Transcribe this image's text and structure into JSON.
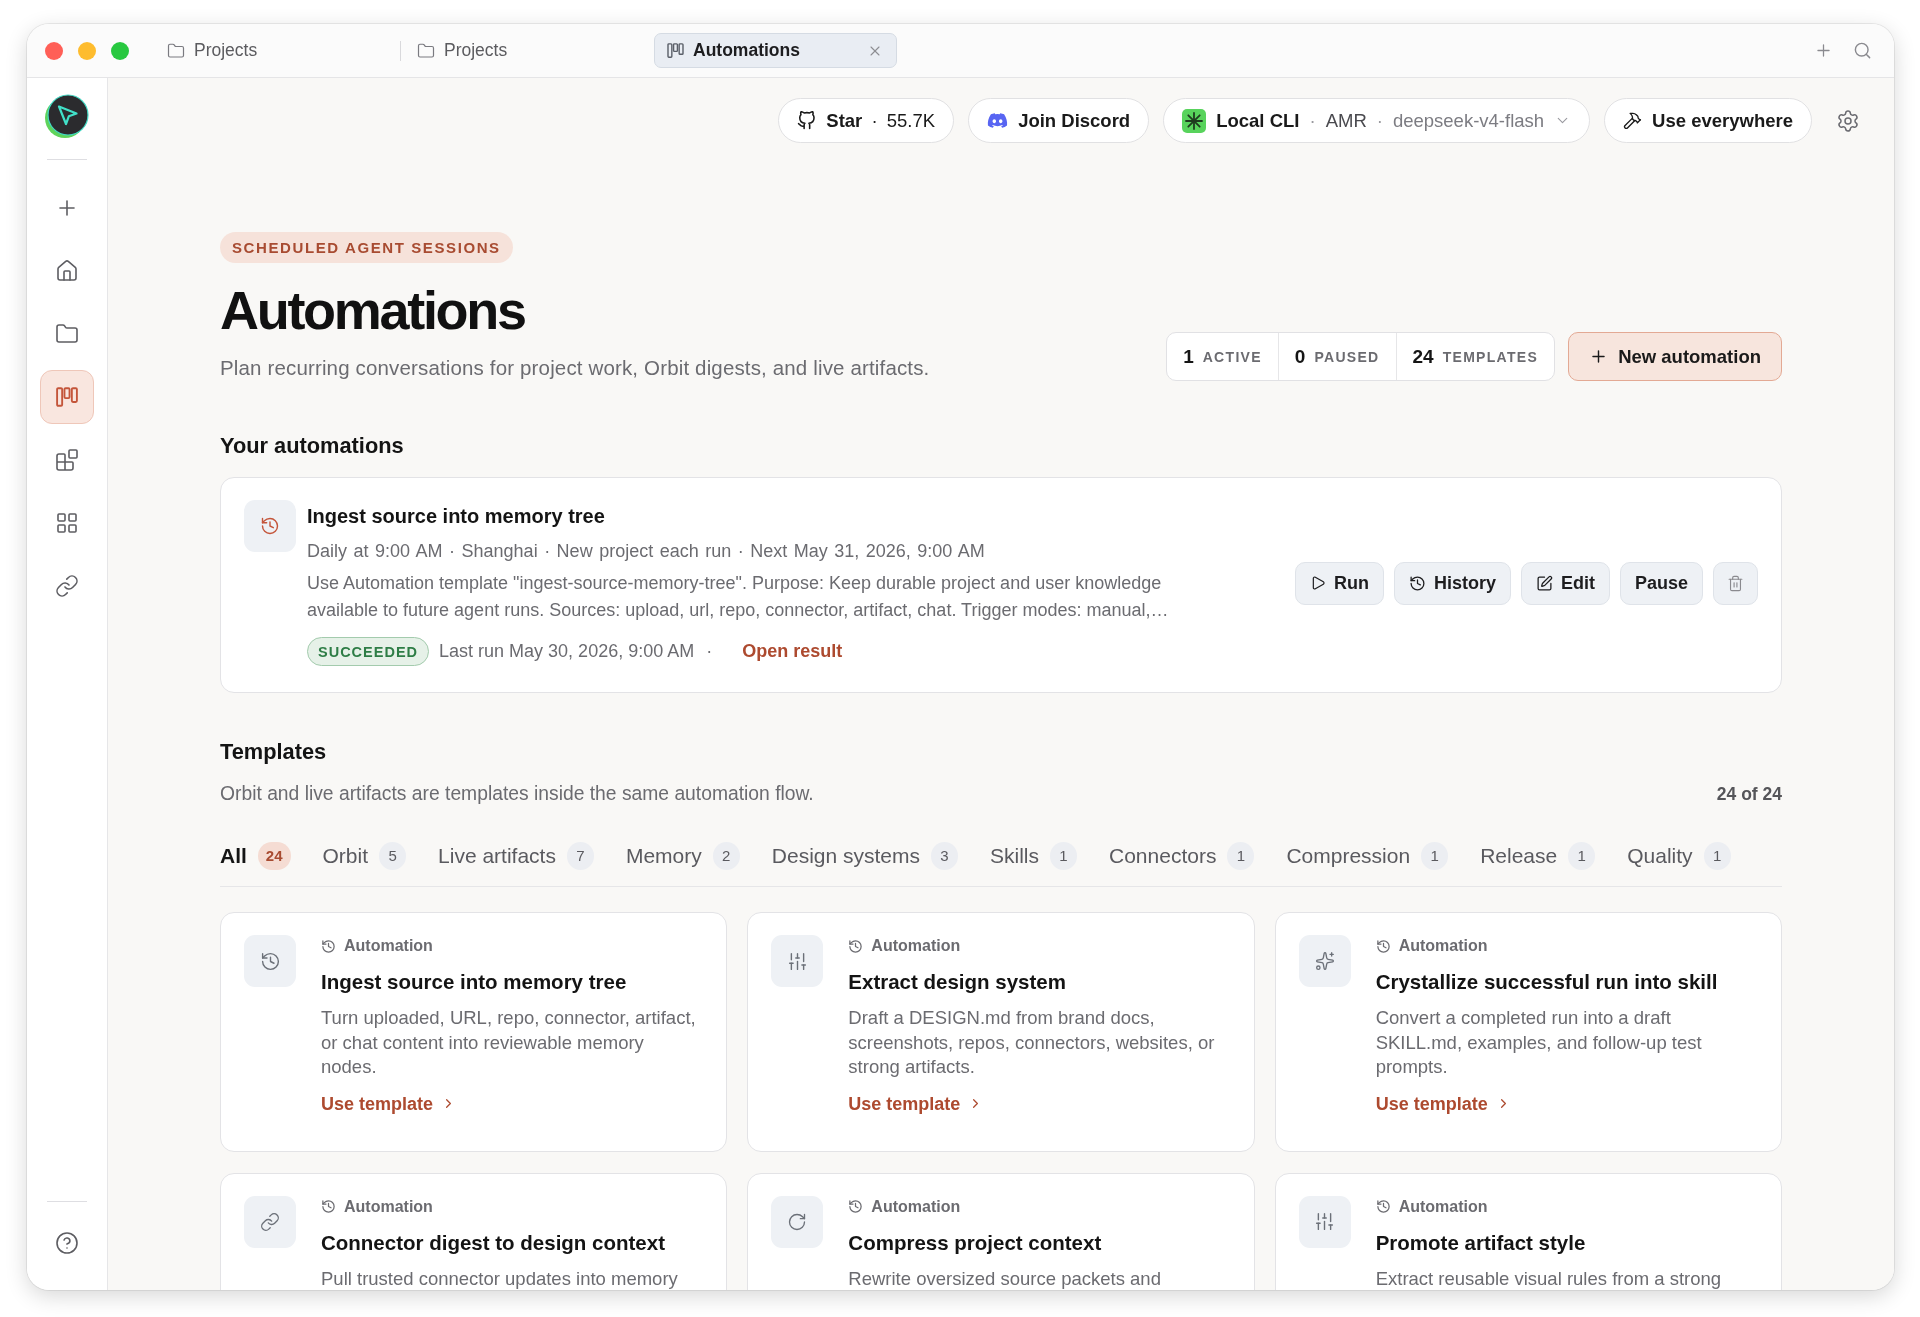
{
  "window": {
    "tabs": [
      {
        "label": "Projects",
        "kind": "project",
        "selected": false
      },
      {
        "label": "Projects",
        "kind": "project",
        "selected": false
      },
      {
        "label": "Automations",
        "kind": "automations",
        "selected": true
      }
    ]
  },
  "sidebar": {
    "items": [
      {
        "selected": false
      },
      {
        "selected": false
      },
      {
        "selected": false
      },
      {
        "selected": true
      },
      {
        "selected": false
      },
      {
        "selected": false
      },
      {
        "selected": false
      }
    ]
  },
  "toolbar": {
    "github": "**Star** · 55.7K",
    "discord": "Join Discord",
    "model_picker": {
      "runtime": "Local CLI",
      "provider": "AMR",
      "model": "deepseek-v4-flash",
      "separator": "·"
    },
    "share": "Use everywhere"
  },
  "header": {
    "eyebrow": "SCHEDULED AGENT SESSIONS",
    "title": "Automations",
    "subtitle": "Plan recurring conversations for project work, Orbit digests, and live artifacts.",
    "stats": [
      {
        "value": "1",
        "label": "ACTIVE"
      },
      {
        "value": "0",
        "label": "PAUSED"
      },
      {
        "value": "24",
        "label": "TEMPLATES"
      }
    ],
    "new_button": "New automation"
  },
  "automations": {
    "title": "Your automations",
    "items": [
      {
        "title": "Ingest source into memory tree",
        "schedule": "Daily at 9:00 AM · Shanghai · New project each run · Next May 31, 2026, 9:00 AM",
        "description": "Use Automation template \"ingest-source-memory-tree\". Purpose: Keep durable project and user knowledge available to future agent runs. Sources: upload, url, repo, connector, artifact, chat. Trigger modes: manual,…",
        "status": {
          "label": "SUCCEEDED",
          "kind": "success"
        },
        "last_run": "Last run May 30, 2026, 9:00 AM",
        "separator": "·",
        "result_link": "Open result",
        "actions": [
          {
            "kind": "run",
            "label": "Run"
          },
          {
            "kind": "history",
            "label": "History"
          },
          {
            "kind": "edit",
            "label": "Edit"
          },
          {
            "kind": "pause",
            "label": "Pause"
          },
          {
            "kind": "delete"
          }
        ]
      }
    ]
  },
  "templates": {
    "title": "Templates",
    "description": "Orbit and live artifacts are templates inside the same automation flow.",
    "count": "24 of 24",
    "filters": [
      {
        "label": "All",
        "count": "24",
        "selected": true
      },
      {
        "label": "Orbit",
        "count": "5",
        "selected": false
      },
      {
        "label": "Live artifacts",
        "count": "7",
        "selected": false
      },
      {
        "label": "Memory",
        "count": "2",
        "selected": false
      },
      {
        "label": "Design systems",
        "count": "3",
        "selected": false
      },
      {
        "label": "Skills",
        "count": "1",
        "selected": false
      },
      {
        "label": "Connectors",
        "count": "1",
        "selected": false
      },
      {
        "label": "Compression",
        "count": "1",
        "selected": false
      },
      {
        "label": "Release",
        "count": "1",
        "selected": false
      },
      {
        "label": "Quality",
        "count": "1",
        "selected": false
      }
    ],
    "cards": [
      {
        "eyebrow": "Automation",
        "title": "Ingest source into memory tree",
        "description": "Turn uploaded, URL, repo, connector, artifact, or chat content into reviewable memory nodes.",
        "action": "Use template"
      },
      {
        "eyebrow": "Automation",
        "title": "Extract design system",
        "description": "Draft a DESIGN.md from brand docs, screenshots, repos, connectors, websites, or strong artifacts.",
        "action": "Use template"
      },
      {
        "eyebrow": "Automation",
        "title": "Crystallize successful run into skill",
        "description": "Convert a completed run into a draft SKILL.md, examples, and follow-up test prompts.",
        "action": "Use template"
      },
      {
        "eyebrow": "Automation",
        "title": "Connector digest to design context",
        "description": "Pull trusted connector updates into memory"
      },
      {
        "eyebrow": "Automation",
        "title": "Compress project context",
        "description": "Rewrite oversized source packets and"
      },
      {
        "eyebrow": "Automation",
        "title": "Promote artifact style",
        "description": "Extract reusable visual rules from a strong"
      }
    ]
  }
}
